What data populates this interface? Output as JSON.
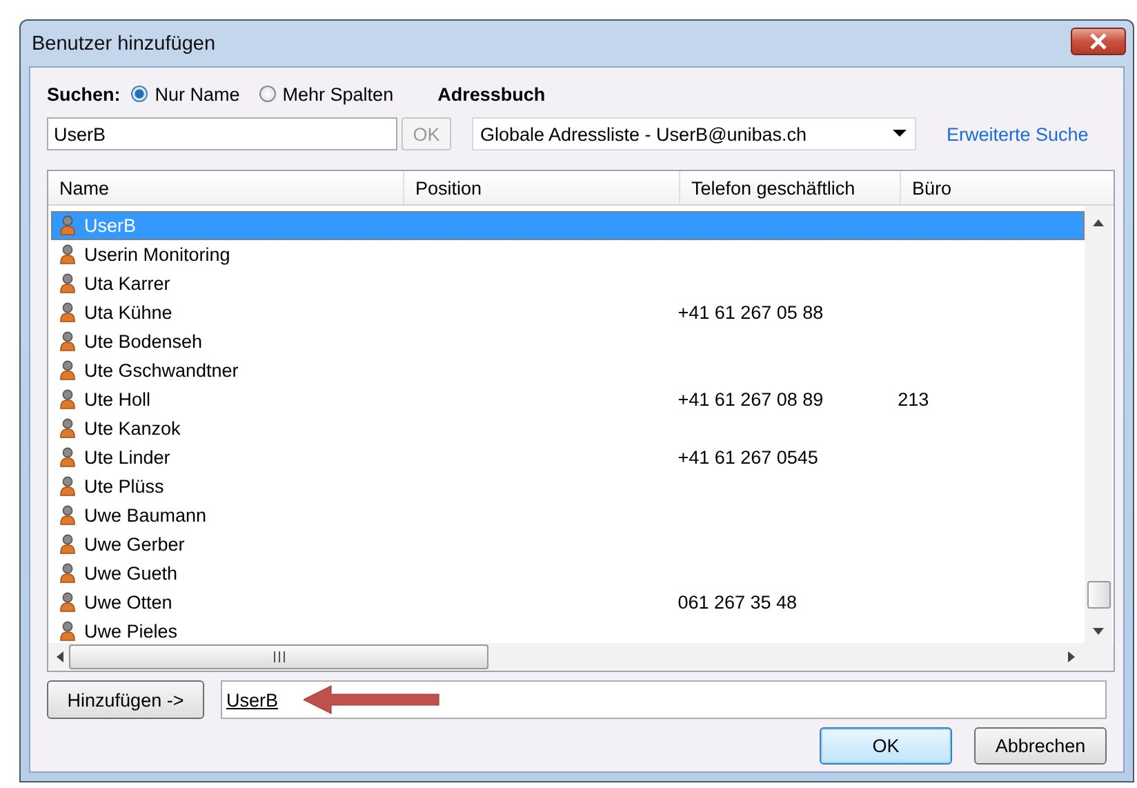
{
  "window": {
    "title": "Benutzer hinzufügen"
  },
  "search": {
    "label": "Suchen:",
    "query": "UserB",
    "ok_button": "OK",
    "ok_disabled": true
  },
  "scope_options": [
    {
      "label": "Nur Name",
      "selected": true
    },
    {
      "label": "Mehr Spalten",
      "selected": false
    }
  ],
  "address_book": {
    "label": "Adressbuch",
    "value": "Globale Adressliste - UserB@unibas.ch"
  },
  "advanced_search_link": "Erweiterte Suche",
  "table": {
    "columns": [
      "Name",
      "Position",
      "Telefon geschäftlich",
      "Büro"
    ],
    "rows": [
      {
        "name": "UserB",
        "selected": true
      },
      {
        "name": "Userin Monitoring",
        "selected": false
      },
      {
        "name": "Uta Karrer",
        "selected": false
      },
      {
        "name": "Uta Kühne",
        "phone": "+41 61 267 05 88",
        "selected": false
      },
      {
        "name": "Ute Bodenseh",
        "selected": false
      },
      {
        "name": "Ute Gschwandtner",
        "selected": false
      },
      {
        "name": "Ute Holl",
        "phone": "+41 61 267 08 89",
        "office": "213",
        "selected": false
      },
      {
        "name": "Ute Kanzok",
        "selected": false
      },
      {
        "name": "Ute Linder",
        "phone": "+41 61 267 0545",
        "selected": false
      },
      {
        "name": "Ute Plüss",
        "selected": false
      },
      {
        "name": "Uwe Baumann",
        "selected": false
      },
      {
        "name": "Uwe Gerber",
        "selected": false
      },
      {
        "name": "Uwe Gueth",
        "selected": false
      },
      {
        "name": "Uwe Otten",
        "phone": "061 267 35 48",
        "selected": false
      },
      {
        "name": "Uwe Pieles",
        "selected": false
      }
    ]
  },
  "add_button": "Hinzufügen ->",
  "recipients": {
    "value": "UserB",
    "resolved": true
  },
  "buttons": [
    {
      "label": "OK",
      "default": true
    },
    {
      "label": "Abbrechen",
      "default": false
    }
  ]
}
